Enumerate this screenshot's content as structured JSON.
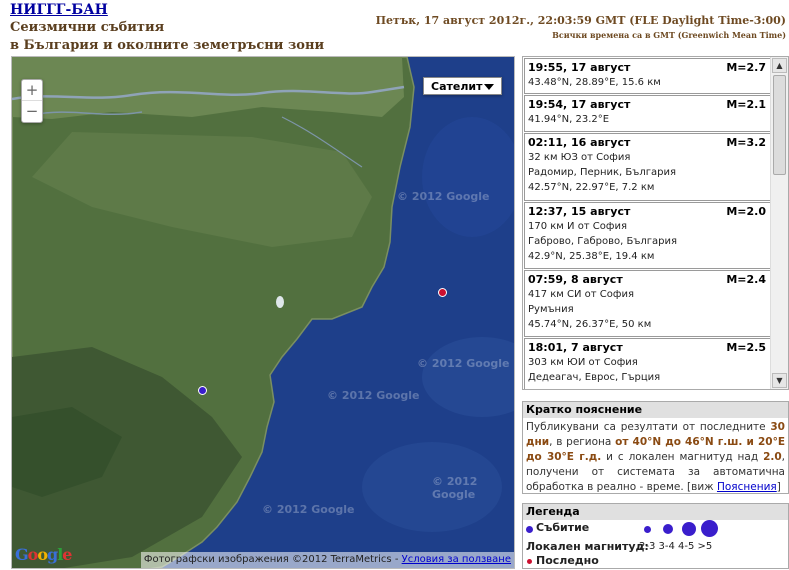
{
  "header": {
    "brand": "НИГГГ-БАН",
    "subtitle_line1": "Сеизмични събития",
    "subtitle_line2": "в България и околните земетръсни зони",
    "datetime": "Петък, 17 август 2012г., 22:03:59 GMT (FLE Daylight Time-3:00)",
    "timezone_note": "Всички времена са в GMT (Greenwich Mean Time)"
  },
  "map": {
    "map_type_label": "Сателит",
    "zoom_in": "+",
    "zoom_out": "−",
    "attribution": "Фотографски изображения ©2012 TerraMetrics - ",
    "terms_link": "Условия за ползване",
    "watermark": "© 2012 Google",
    "logo_letters": [
      "G",
      "o",
      "o",
      "g",
      "l",
      "e"
    ],
    "colors": {
      "land": "#4e6b3d",
      "sea": "#1e3f8a",
      "marker_event": "#3a1ecc",
      "marker_latest": "#cc1030"
    }
  },
  "events": [
    {
      "when": "19:55, 17 август",
      "mag": "M=2.7",
      "lines": [
        "43.48°N, 28.89°E, 15.6 км"
      ]
    },
    {
      "when": "19:54, 17 август",
      "mag": "M=2.1",
      "lines": [
        "41.94°N, 23.2°E"
      ]
    },
    {
      "when": "02:11, 16 август",
      "mag": "M=3.2",
      "lines": [
        "32 км ЮЗ от София",
        "Радомир, Перник, България",
        "42.57°N, 22.97°E, 7.2 км"
      ]
    },
    {
      "when": "12:37, 15 август",
      "mag": "M=2.0",
      "lines": [
        "170 км И от София",
        "Габрово, Габрово, България",
        "42.9°N, 25.38°E, 19.4 км"
      ]
    },
    {
      "when": "07:59, 8 август",
      "mag": "M=2.4",
      "lines": [
        "417 км СИ от София",
        "Румъния",
        "45.74°N, 26.37°E, 50 км"
      ]
    },
    {
      "when": "18:01, 7 август",
      "mag": "M=2.5",
      "lines": [
        "303 км ЮИ от София",
        "Дедеагач, Еврос, Гърция"
      ]
    }
  ],
  "explanation": {
    "title": "Кратко пояснение",
    "t1": "Публикувани са резултати от последните ",
    "b1": "30 дни",
    "t2": ", в региона ",
    "b2": "от 40°N до 46°N г.ш. и 20°E до 30°E г.д.",
    "t3": " и с локален магнитуд над ",
    "b3": "2.0",
    "t4": ", получени от системата за автоматична обработка в реално - време. [виж ",
    "link": "Пояснения",
    "t5": "]"
  },
  "legend": {
    "title": "Легенда",
    "event_label": "Събитие",
    "magnitude_label": "Локален магнитуд:",
    "magnitude_ranges": "2-3 3-4 4-5 >5",
    "latest_label": "Последно"
  }
}
